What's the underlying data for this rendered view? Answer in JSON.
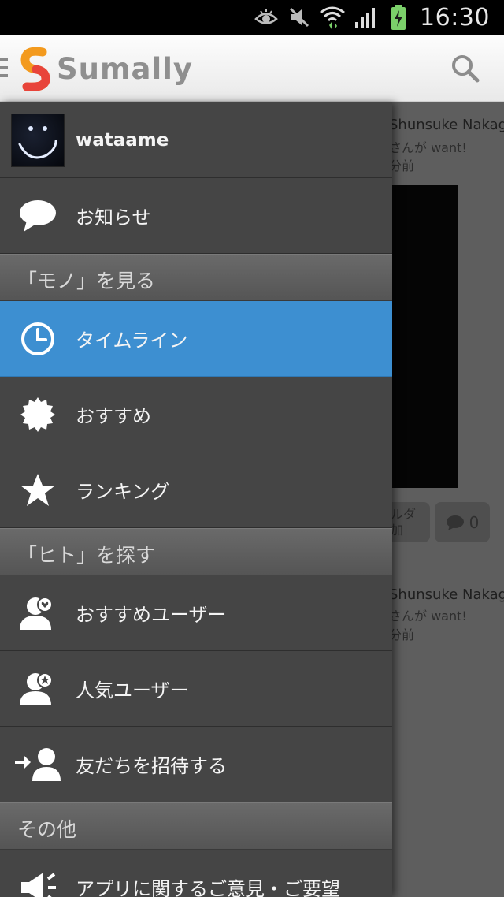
{
  "status_bar": {
    "time": "16:30",
    "icons": [
      "eye-icon",
      "mute-icon",
      "wifi-icon",
      "signal-icon",
      "battery-charging-icon"
    ]
  },
  "action_bar": {
    "brand": "Sumally",
    "logo_letter": "S",
    "icons": [
      "menu-icon",
      "logo-icon",
      "search-icon"
    ]
  },
  "background_feed": {
    "items": [
      {
        "name": "Shunsuke Nakag...",
        "action": "さんが want!",
        "time": "分前"
      },
      {
        "name": "Shunsuke Nakag...",
        "action": "さんが want!",
        "time": "分前"
      }
    ],
    "folder_label_1": "ルダ",
    "folder_label_2": "加",
    "comment_count": "0"
  },
  "drawer": {
    "profile": {
      "username": "wataame"
    },
    "notifications": {
      "label": "お知らせ",
      "icon": "speech-bubble-icon"
    },
    "section_items": {
      "title": "「モノ」を見る"
    },
    "items_menu": [
      {
        "label": "タイムライン",
        "icon": "clock-icon",
        "active": true
      },
      {
        "label": "おすすめ",
        "icon": "badge-icon",
        "active": false
      },
      {
        "label": "ランキング",
        "icon": "star-icon",
        "active": false
      }
    ],
    "section_people": {
      "title": "「ヒト」を探す"
    },
    "people_menu": [
      {
        "label": "おすすめユーザー",
        "icon": "user-heart-icon"
      },
      {
        "label": "人気ユーザー",
        "icon": "user-star-icon"
      },
      {
        "label": "友だちを招待する",
        "icon": "invite-user-icon"
      }
    ],
    "section_other": {
      "title": "その他"
    },
    "other_menu": [
      {
        "label": "アプリに関するご意見・ご要望",
        "icon": "megaphone-icon"
      }
    ]
  },
  "colors": {
    "drawer_bg": "#454545",
    "active_bg": "#3d8fd1",
    "logo_orange": "#f39a1e",
    "logo_red": "#e8443a"
  }
}
